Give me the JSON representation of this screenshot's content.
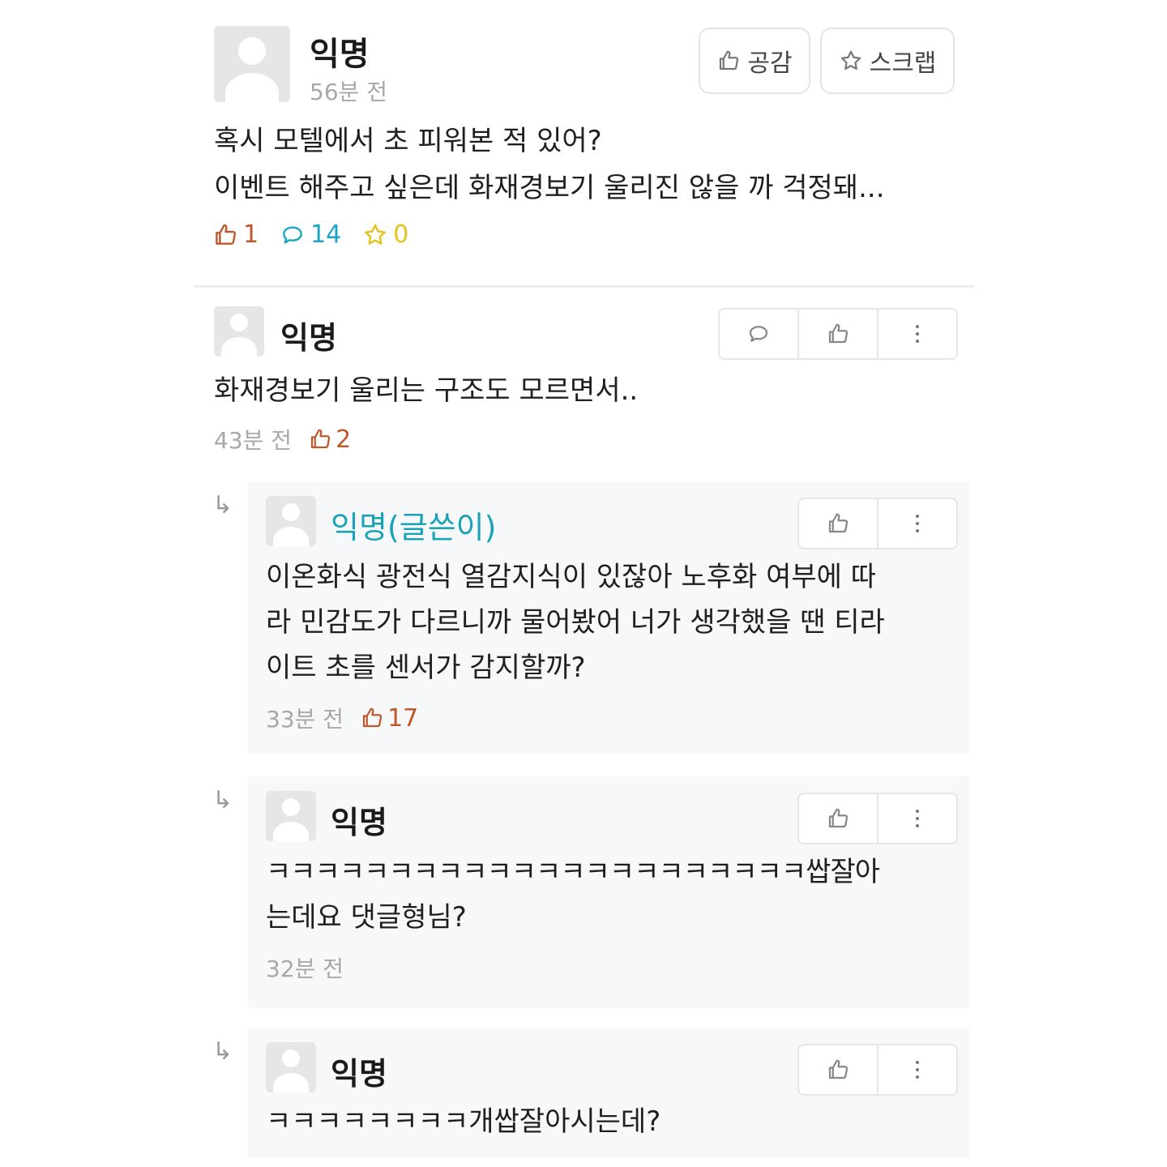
{
  "post": {
    "author": "익명",
    "time": "56분 전",
    "like_button": "공감",
    "scrap_button": "스크랩",
    "lines": [
      "혹시 모텔에서 초 피워본 적 있어?",
      "이벤트 해주고 싶은데 화재경보기 울리진 않을 까 걱정돼..."
    ],
    "stats": {
      "likes": "1",
      "comments": "14",
      "scraps": "0"
    },
    "colors": {
      "like": "#c0582e",
      "comment": "#1ba5c4",
      "scrap": "#e5c21a"
    }
  },
  "comments": [
    {
      "author": "익명",
      "lines": [
        "화재경보기 울리는 구조도 모르면서.."
      ],
      "time": "43분 전",
      "votes": "2"
    }
  ],
  "replies": [
    {
      "author": "익명(글쓴이)",
      "lines": [
        "이온화식 광전식 열감지식이 있잖아 노후화 여부에 따",
        "라 민감도가 다르니까 물어봤어 너가 생각했을 땐 티라",
        "이트 초를 센서가 감지할까?"
      ],
      "time": "33분 전",
      "votes": "17"
    },
    {
      "author": "익명",
      "lines": [
        "ㅋㅋㅋㅋㅋㅋㅋㅋㅋㅋㅋㅋㅋㅋㅋㅋㅋㅋㅋㅋㅋㅋ쌉잘아",
        "는데요 댓글형님?"
      ],
      "time": "32분 전"
    },
    {
      "author": "익명",
      "lines": [
        "ㅋㅋㅋㅋㅋㅋㅋㅋ개쌉잘아시는데?"
      ]
    }
  ],
  "icons": {
    "thumbs_up": "thumbs-up-icon",
    "comment": "comment-icon",
    "star": "star-icon",
    "more": "more-vertical-icon",
    "reply_arrow": "↳"
  },
  "author_color": "#1aa3b8"
}
